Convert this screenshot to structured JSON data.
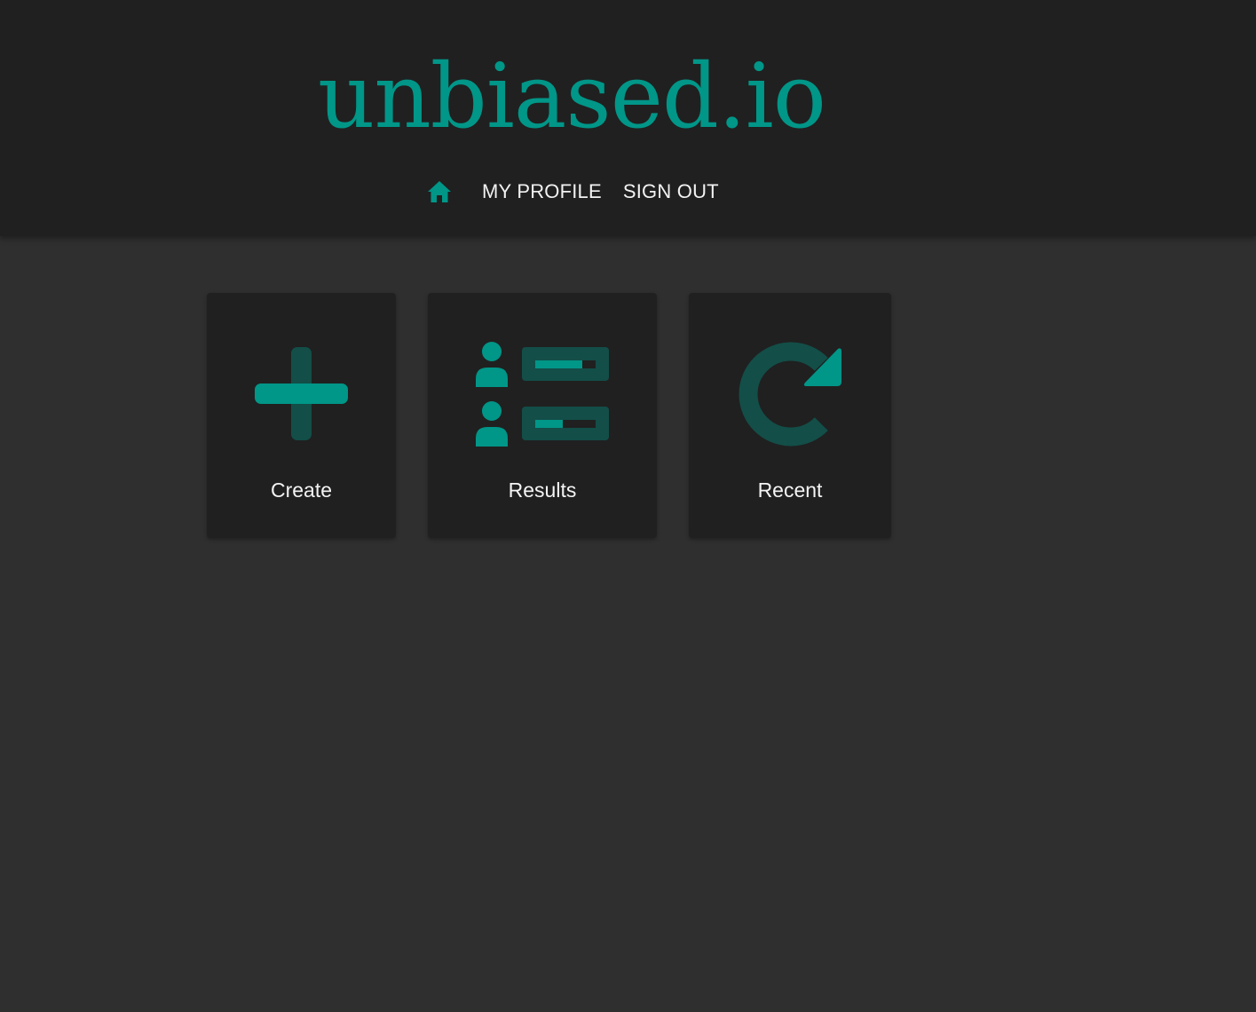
{
  "app": {
    "logo_text": "unbiased.io"
  },
  "nav": {
    "home_icon": "home-icon",
    "items": [
      {
        "label": "MY PROFILE"
      },
      {
        "label": "SIGN OUT"
      }
    ]
  },
  "cards": [
    {
      "label": "Create",
      "icon": "plus-icon"
    },
    {
      "label": "Results",
      "icon": "results-list-icon"
    },
    {
      "label": "Recent",
      "icon": "refresh-icon"
    }
  ],
  "colors": {
    "accent": "#009688",
    "accent_dark": "#134e48",
    "header_bg": "#202020",
    "page_bg": "#2f2f2f",
    "card_bg": "#202020",
    "text": "#f4f4f4"
  }
}
